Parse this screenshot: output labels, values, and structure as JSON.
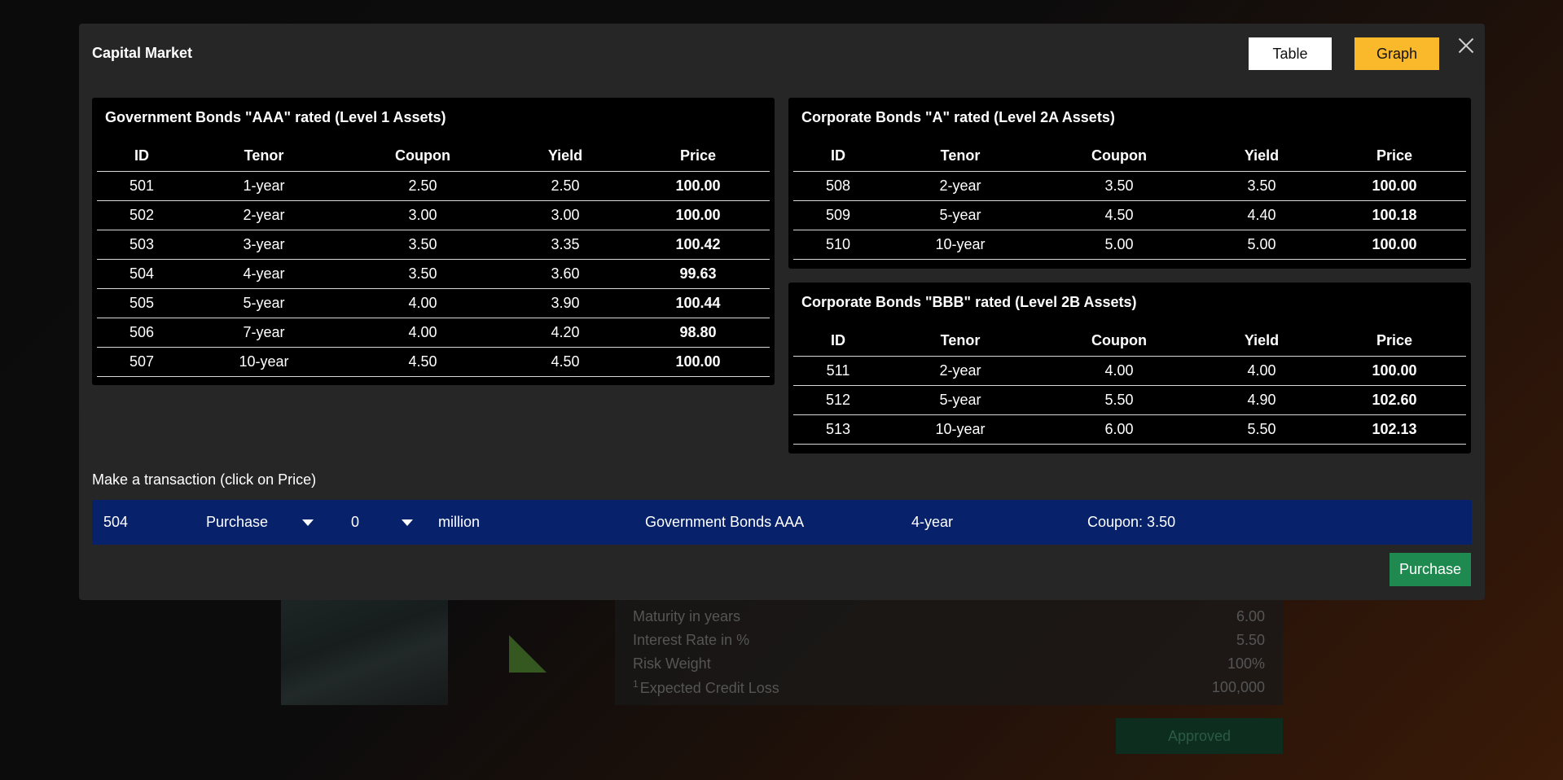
{
  "modal": {
    "title": "Capital Market",
    "view_toggle": {
      "table_label": "Table",
      "graph_label": "Graph"
    }
  },
  "panels": [
    {
      "title": "Government Bonds \"AAA\" rated (Level 1 Assets)",
      "headers": [
        "ID",
        "Tenor",
        "Coupon",
        "Yield",
        "Price"
      ],
      "rows": [
        [
          "501",
          "1-year",
          "2.50",
          "2.50",
          "100.00"
        ],
        [
          "502",
          "2-year",
          "3.00",
          "3.00",
          "100.00"
        ],
        [
          "503",
          "3-year",
          "3.50",
          "3.35",
          "100.42"
        ],
        [
          "504",
          "4-year",
          "3.50",
          "3.60",
          "99.63"
        ],
        [
          "505",
          "5-year",
          "4.00",
          "3.90",
          "100.44"
        ],
        [
          "506",
          "7-year",
          "4.00",
          "4.20",
          "98.80"
        ],
        [
          "507",
          "10-year",
          "4.50",
          "4.50",
          "100.00"
        ]
      ]
    },
    {
      "title": "Corporate Bonds \"A\" rated (Level 2A Assets)",
      "headers": [
        "ID",
        "Tenor",
        "Coupon",
        "Yield",
        "Price"
      ],
      "rows": [
        [
          "508",
          "2-year",
          "3.50",
          "3.50",
          "100.00"
        ],
        [
          "509",
          "5-year",
          "4.50",
          "4.40",
          "100.18"
        ],
        [
          "510",
          "10-year",
          "5.00",
          "5.00",
          "100.00"
        ]
      ]
    },
    {
      "title": "Corporate Bonds \"BBB\" rated (Level 2B Assets)",
      "headers": [
        "ID",
        "Tenor",
        "Coupon",
        "Yield",
        "Price"
      ],
      "rows": [
        [
          "511",
          "2-year",
          "4.00",
          "4.00",
          "100.00"
        ],
        [
          "512",
          "5-year",
          "5.50",
          "4.90",
          "102.60"
        ],
        [
          "513",
          "10-year",
          "6.00",
          "5.50",
          "102.13"
        ]
      ]
    }
  ],
  "transaction": {
    "label": "Make a transaction (click on Price)",
    "id": "504",
    "action": "Purchase",
    "amount": "0",
    "unit": "million",
    "bond_type": "Government Bonds AAA",
    "tenor": "4-year",
    "coupon": "Coupon: 3.50",
    "submit_label": "Purchase"
  },
  "background": {
    "info_rows": [
      {
        "label": "Maturity in years",
        "value": "6.00"
      },
      {
        "label": "Interest Rate in %",
        "value": "5.50"
      },
      {
        "label": "Risk Weight",
        "value": "100%"
      },
      {
        "footnote": "1",
        "label": "Expected Credit Loss",
        "value": "100,000"
      }
    ],
    "approved_label": "Approved"
  },
  "colors": {
    "modal_bg": "#262626",
    "graph_button": "#f9b92a",
    "transaction_bar": "#07226a",
    "purchase_button": "#1e8a4f"
  },
  "icons": {
    "close": "close-icon",
    "dropdown": "caret-down-icon"
  }
}
